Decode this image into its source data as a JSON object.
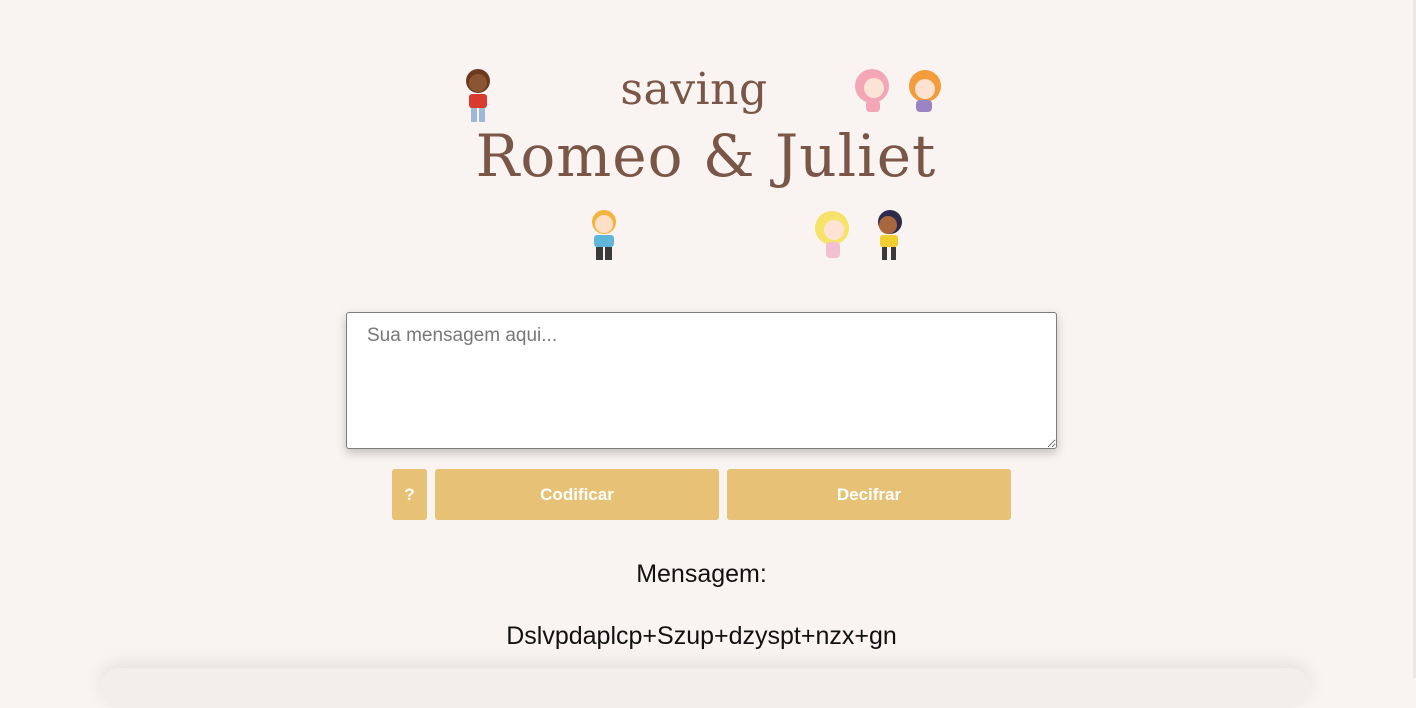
{
  "logo": {
    "line1": "saving",
    "line2": "Romeo & Juliet"
  },
  "input": {
    "placeholder": "Sua mensagem aqui...",
    "value": ""
  },
  "buttons": {
    "help": "?",
    "encode": "Codificar",
    "decode": "Decifrar"
  },
  "result": {
    "heading": "Mensagem:",
    "text": "Dslvpdaplcp+Szup+dzyspt+nzx+gn"
  },
  "colors": {
    "background": "#f9f3f1",
    "button": "#e7c175",
    "logo_text": "#7a5647"
  }
}
